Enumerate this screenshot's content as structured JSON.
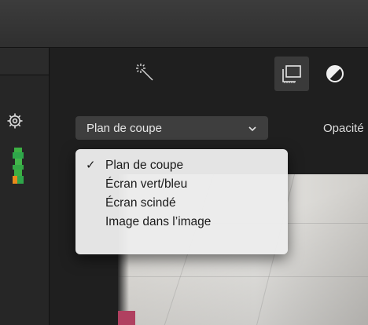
{
  "toolbar": {
    "effects_icon": "magic-wand-icon",
    "crop_icon": "crop-icon",
    "color_icon": "color-balance-icon"
  },
  "sidebar": {
    "settings_icon": "gear-icon"
  },
  "inspector": {
    "mode_select": {
      "selected": "Plan de coupe"
    },
    "opacity_label": "Opacité"
  },
  "menu": {
    "items": [
      {
        "label": "Plan de coupe",
        "checked": true
      },
      {
        "label": "Écran vert/bleu",
        "checked": false
      },
      {
        "label": "Écran scindé",
        "checked": false
      },
      {
        "label": "Image dans l’image",
        "checked": false
      }
    ],
    "check_mark": "✓"
  },
  "colors": {
    "menu_bg": "#ececec",
    "select_bg": "#3e3e3e",
    "panel_bg": "#1f1f1f"
  }
}
